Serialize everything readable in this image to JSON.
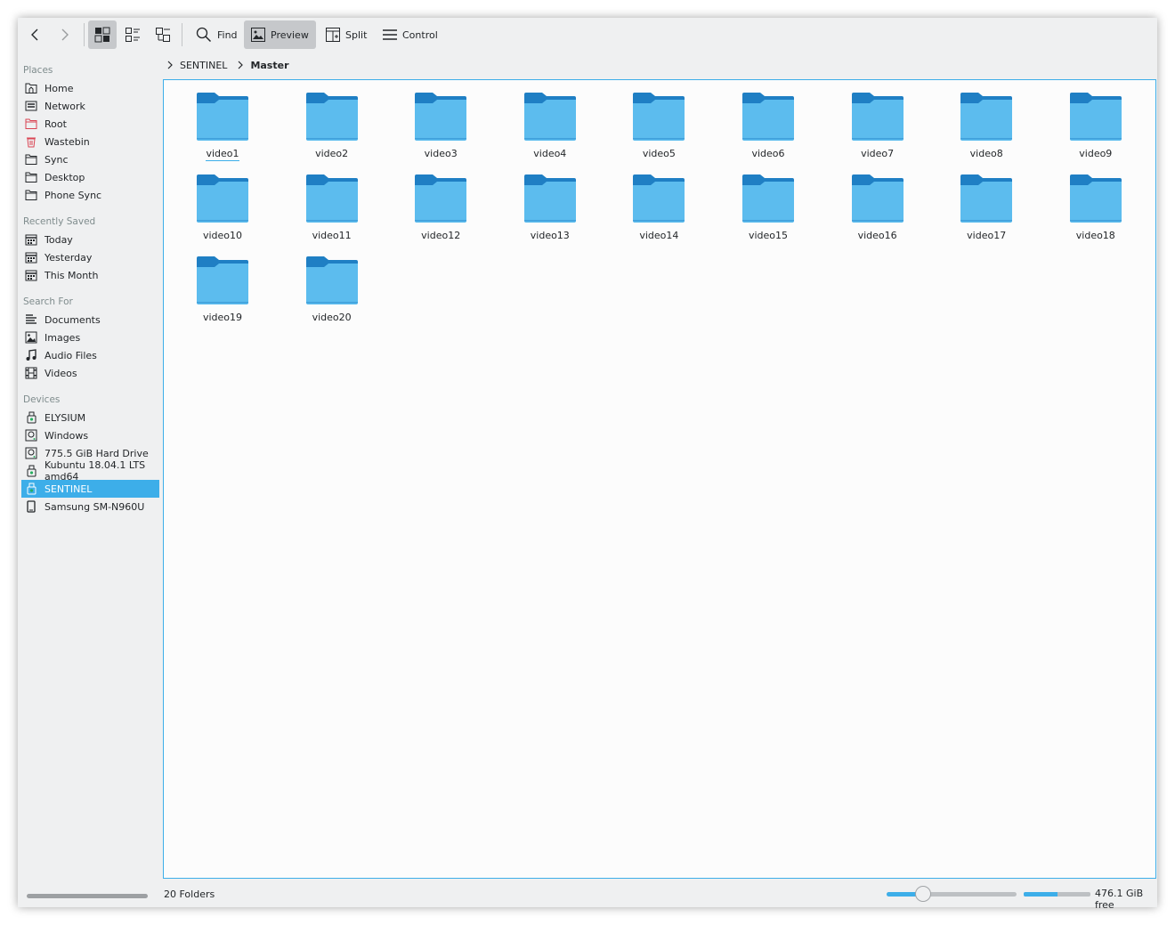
{
  "toolbar": {
    "find_label": "Find",
    "preview_label": "Preview",
    "split_label": "Split",
    "control_label": "Control"
  },
  "sidebar": {
    "sections": [
      {
        "title": "Places",
        "items": [
          {
            "label": "Home",
            "icon": "home-icon"
          },
          {
            "label": "Network",
            "icon": "network-icon"
          },
          {
            "label": "Root",
            "icon": "folder-red-icon"
          },
          {
            "label": "Wastebin",
            "icon": "trash-icon"
          },
          {
            "label": "Sync",
            "icon": "folder-icon"
          },
          {
            "label": "Desktop",
            "icon": "folder-icon"
          },
          {
            "label": "Phone Sync",
            "icon": "folder-icon"
          }
        ]
      },
      {
        "title": "Recently Saved",
        "items": [
          {
            "label": "Today",
            "icon": "calendar-icon"
          },
          {
            "label": "Yesterday",
            "icon": "calendar-icon"
          },
          {
            "label": "This Month",
            "icon": "calendar-icon"
          }
        ]
      },
      {
        "title": "Search For",
        "items": [
          {
            "label": "Documents",
            "icon": "document-icon"
          },
          {
            "label": "Images",
            "icon": "image-icon"
          },
          {
            "label": "Audio Files",
            "icon": "music-icon"
          },
          {
            "label": "Videos",
            "icon": "film-icon"
          }
        ]
      },
      {
        "title": "Devices",
        "items": [
          {
            "label": "ELYSIUM",
            "icon": "usb-drive-icon"
          },
          {
            "label": "Windows",
            "icon": "hard-drive-icon"
          },
          {
            "label": "775.5 GiB Hard Drive",
            "icon": "hard-drive-icon"
          },
          {
            "label": "Kubuntu 18.04.1 LTS amd64",
            "icon": "usb-drive-icon"
          },
          {
            "label": "SENTINEL",
            "icon": "usb-drive-icon"
          },
          {
            "label": "Samsung SM-N960U",
            "icon": "phone-icon"
          }
        ]
      }
    ]
  },
  "breadcrumb": [
    "SENTINEL",
    "Master"
  ],
  "folders": [
    "video1",
    "video2",
    "video3",
    "video4",
    "video5",
    "video6",
    "video7",
    "video8",
    "video9",
    "video10",
    "video11",
    "video12",
    "video13",
    "video14",
    "video15",
    "video16",
    "video17",
    "video18",
    "video19",
    "video20"
  ],
  "status": {
    "folder_count": "20 Folders",
    "free_space": "476.1 GiB free",
    "zoom_level": 0.28,
    "space_used_fraction": 0.5
  },
  "colors": {
    "accent": "#3daee9",
    "folder_light": "#5cbcee",
    "folder_dark": "#1f7fc4"
  }
}
